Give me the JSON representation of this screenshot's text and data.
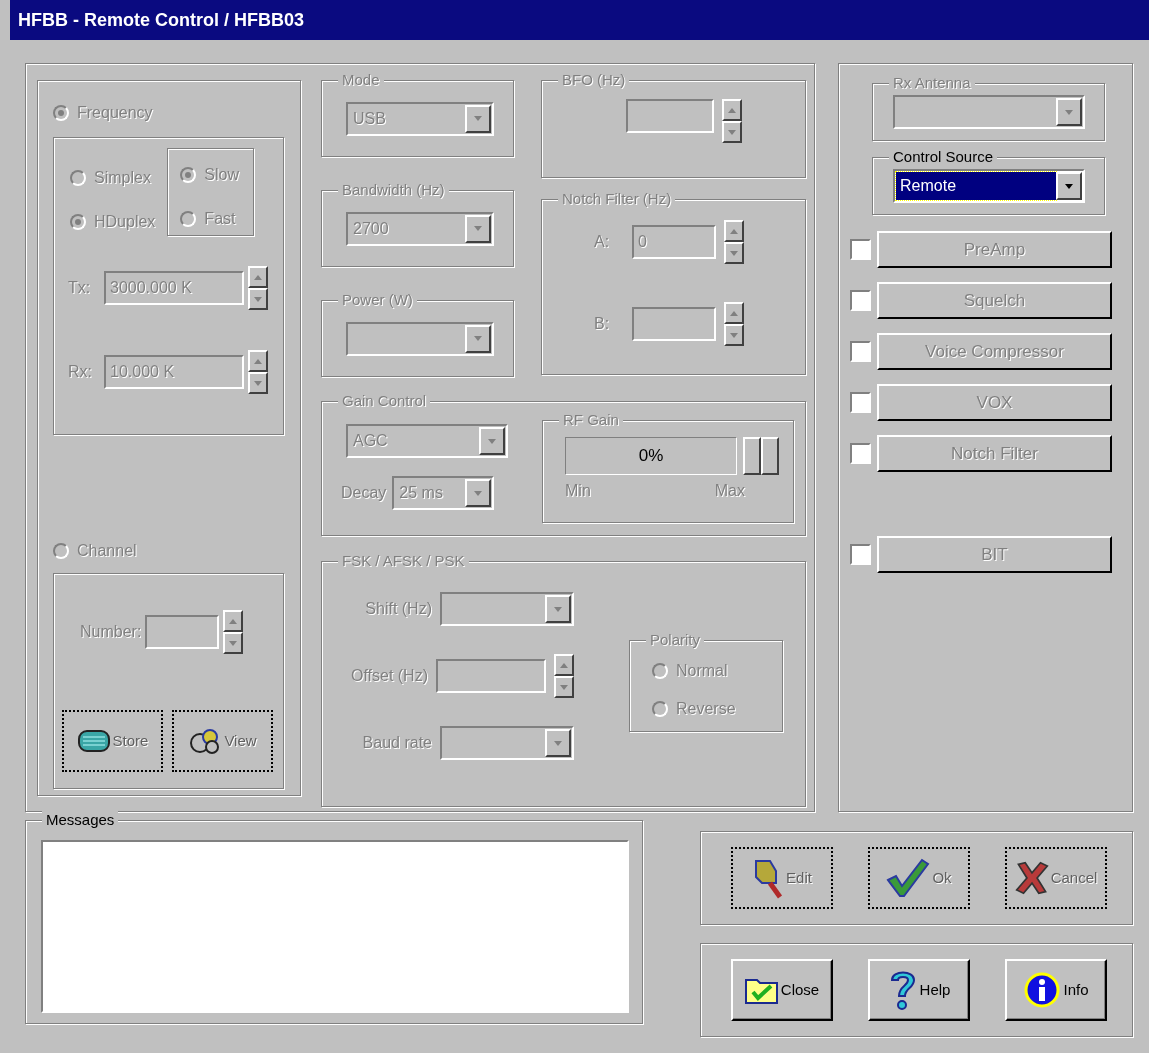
{
  "window": {
    "title": "HFBB - Remote Control / HFBB03"
  },
  "main_panel": {
    "disabled": true
  },
  "frequency": {
    "label": "Frequency",
    "selected": true,
    "duplex_options": [
      {
        "label": "Simplex",
        "selected": false
      },
      {
        "label": "HDuplex",
        "selected": true
      }
    ],
    "speed_options": [
      {
        "label": "Slow",
        "selected": true
      },
      {
        "label": "Fast",
        "selected": false
      }
    ],
    "tx": {
      "label": "Tx:",
      "value": "3000.000 K"
    },
    "rx": {
      "label": "Rx:",
      "value": "10.000 K"
    }
  },
  "channel": {
    "label": "Channel",
    "selected": false,
    "number_label": "Number:",
    "buttons": [
      {
        "label": "Store",
        "kind": "store"
      },
      {
        "label": "View",
        "kind": "view"
      }
    ]
  },
  "mode": {
    "label": "Mode",
    "value": "USB"
  },
  "bandwidth": {
    "label": "Bandwidth (Hz)",
    "value": "2700"
  },
  "power": {
    "label": "Power (W)"
  },
  "bfo": {
    "label": "BFO (Hz)"
  },
  "notch_filter": {
    "label": "Notch Filter (Hz)",
    "a_label": "A:",
    "a_value": "0",
    "b_label": "B:"
  },
  "gain_control": {
    "label": "Gain Control",
    "value": "AGC",
    "decay_label": "Decay",
    "decay_value": "25 ms",
    "rf_gain": {
      "label": "RF Gain",
      "reading": "0%",
      "level": 0,
      "min_label": "Min",
      "max_label": "Max"
    }
  },
  "fsk": {
    "label": "FSK / AFSK / PSK",
    "shift_label": "Shift (Hz)",
    "offset_label": "Offset (Hz)",
    "baud_label": "Baud rate",
    "polarity": {
      "label": "Polarity",
      "options": [
        {
          "label": "Normal",
          "selected": false
        },
        {
          "label": "Reverse",
          "selected": false
        }
      ]
    }
  },
  "rx_antenna": {
    "label": "Rx Antenna",
    "disabled": true
  },
  "control_source": {
    "label": "Control Source",
    "value": "Remote",
    "disabled": false
  },
  "toggles": [
    {
      "label": "PreAmp",
      "checked": false
    },
    {
      "label": "Squelch",
      "checked": false
    },
    {
      "label": "Voice Compressor",
      "checked": false
    },
    {
      "label": "VOX",
      "checked": false
    },
    {
      "label": "Notch Filter",
      "checked": false
    }
  ],
  "bit_toggle": {
    "label": "BIT",
    "checked": false
  },
  "messages": {
    "label": "Messages"
  },
  "action_buttons": [
    {
      "label": "Edit",
      "kind": "edit",
      "disabled": true
    },
    {
      "label": "Ok",
      "kind": "ok",
      "disabled": true
    },
    {
      "label": "Cancel",
      "kind": "cancel",
      "disabled": true
    }
  ],
  "dialog_buttons": [
    {
      "label": "Close",
      "kind": "close",
      "disabled": false
    },
    {
      "label": "Help",
      "kind": "help",
      "disabled": false
    },
    {
      "label": "Info",
      "kind": "info",
      "disabled": false
    }
  ]
}
